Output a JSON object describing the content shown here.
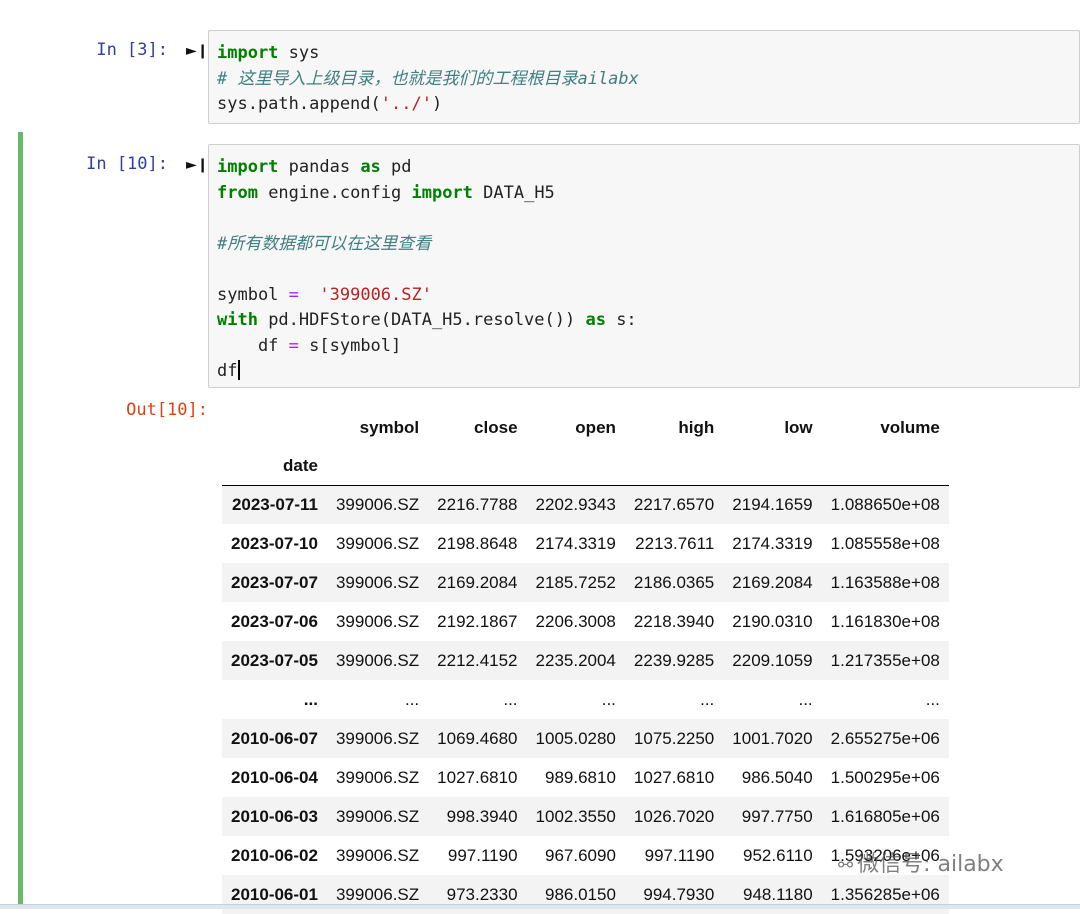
{
  "cells": [
    {
      "prompt": "In  [3]:",
      "lines": [
        [
          {
            "t": "import",
            "c": "kw"
          },
          {
            "t": " sys",
            "c": ""
          }
        ],
        [
          {
            "t": "# 这里导入上级目录，也就是我们的工程根目录ailabx",
            "c": "cm"
          }
        ],
        [
          {
            "t": "sys.path.append(",
            "c": ""
          },
          {
            "t": "'../'",
            "c": "st"
          },
          {
            "t": ")",
            "c": ""
          }
        ]
      ]
    },
    {
      "prompt": "In  [10]:",
      "lines": [
        [
          {
            "t": "import",
            "c": "kw"
          },
          {
            "t": " pandas ",
            "c": ""
          },
          {
            "t": "as",
            "c": "kw"
          },
          {
            "t": " pd",
            "c": ""
          }
        ],
        [
          {
            "t": "from",
            "c": "kw"
          },
          {
            "t": " engine.config ",
            "c": ""
          },
          {
            "t": "import",
            "c": "kw"
          },
          {
            "t": " DATA_H5",
            "c": ""
          }
        ],
        [],
        [
          {
            "t": "#所有数据都可以在这里查看",
            "c": "cm"
          }
        ],
        [],
        [
          {
            "t": "symbol ",
            "c": ""
          },
          {
            "t": "=",
            "c": "op"
          },
          {
            "t": "  ",
            "c": ""
          },
          {
            "t": "'399006.SZ'",
            "c": "st"
          }
        ],
        [
          {
            "t": "with",
            "c": "kw"
          },
          {
            "t": " pd.HDFStore(DATA_H5.resolve()) ",
            "c": ""
          },
          {
            "t": "as",
            "c": "kw"
          },
          {
            "t": " s:",
            "c": ""
          }
        ],
        [
          {
            "t": "    df ",
            "c": ""
          },
          {
            "t": "=",
            "c": "op"
          },
          {
            "t": " s[symbol]",
            "c": ""
          }
        ],
        [
          {
            "t": "df",
            "c": ""
          }
        ]
      ],
      "out_prompt": "Out[10]:"
    }
  ],
  "dataframe": {
    "index_name": "date",
    "columns": [
      "symbol",
      "close",
      "open",
      "high",
      "low",
      "volume"
    ],
    "rows": [
      [
        "2023-07-11",
        "399006.SZ",
        "2216.7788",
        "2202.9343",
        "2217.6570",
        "2194.1659",
        "1.088650e+08"
      ],
      [
        "2023-07-10",
        "399006.SZ",
        "2198.8648",
        "2174.3319",
        "2213.7611",
        "2174.3319",
        "1.085558e+08"
      ],
      [
        "2023-07-07",
        "399006.SZ",
        "2169.2084",
        "2185.7252",
        "2186.0365",
        "2169.2084",
        "1.163588e+08"
      ],
      [
        "2023-07-06",
        "399006.SZ",
        "2192.1867",
        "2206.3008",
        "2218.3940",
        "2190.0310",
        "1.161830e+08"
      ],
      [
        "2023-07-05",
        "399006.SZ",
        "2212.4152",
        "2235.2004",
        "2239.9285",
        "2209.1059",
        "1.217355e+08"
      ],
      [
        "...",
        "...",
        "...",
        "...",
        "...",
        "...",
        "..."
      ],
      [
        "2010-06-07",
        "399006.SZ",
        "1069.4680",
        "1005.0280",
        "1075.2250",
        "1001.7020",
        "2.655275e+06"
      ],
      [
        "2010-06-04",
        "399006.SZ",
        "1027.6810",
        "989.6810",
        "1027.6810",
        "986.5040",
        "1.500295e+06"
      ],
      [
        "2010-06-03",
        "399006.SZ",
        "998.3940",
        "1002.3550",
        "1026.7020",
        "997.7750",
        "1.616805e+06"
      ],
      [
        "2010-06-02",
        "399006.SZ",
        "997.1190",
        "967.6090",
        "997.1190",
        "952.6110",
        "1.593206e+06"
      ],
      [
        "2010-06-01",
        "399006.SZ",
        "973.2330",
        "986.0150",
        "994.7930",
        "948.1180",
        "1.356285e+06"
      ]
    ]
  },
  "watermark": "微信号: ailabx",
  "icons": {
    "run": "run-cell-icon",
    "wechat": "wechat-icon"
  }
}
